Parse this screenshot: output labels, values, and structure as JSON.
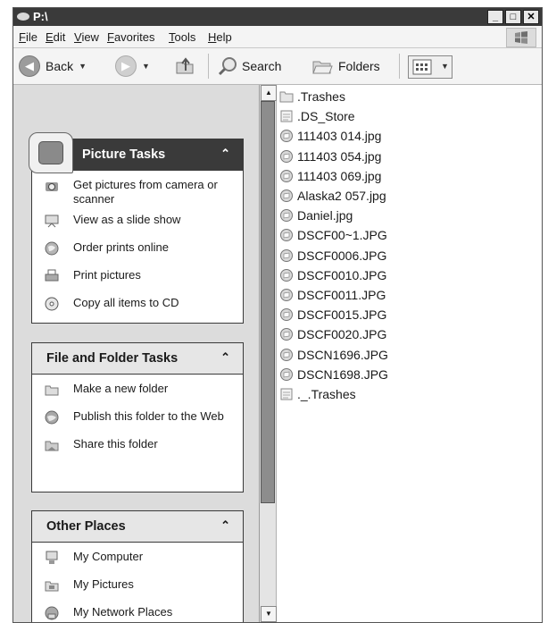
{
  "window": {
    "title": "P:\\"
  },
  "menu": [
    {
      "name": "file",
      "label": "File"
    },
    {
      "name": "edit",
      "label": "Edit"
    },
    {
      "name": "view",
      "label": "View"
    },
    {
      "name": "favorites",
      "label": "Favorites"
    },
    {
      "name": "tools",
      "label": "Tools"
    },
    {
      "name": "help",
      "label": "Help"
    }
  ],
  "toolbar": {
    "back_label": "Back",
    "search_label": "Search",
    "folders_label": "Folders"
  },
  "picture_tasks": {
    "title": "Picture Tasks",
    "items": [
      {
        "label": "Get pictures from camera or scanner",
        "icon": "camera-icon"
      },
      {
        "label": "View as a slide show",
        "icon": "slideshow-icon"
      },
      {
        "label": "Order prints online",
        "icon": "globe-icon"
      },
      {
        "label": "Print pictures",
        "icon": "printer-icon"
      },
      {
        "label": "Copy all items to CD",
        "icon": "cd-icon"
      }
    ]
  },
  "folder_tasks": {
    "title": "File and Folder Tasks",
    "items": [
      {
        "label": "Make a new folder",
        "icon": "new-folder-icon"
      },
      {
        "label": "Publish this folder to the Web",
        "icon": "globe-icon"
      },
      {
        "label": "Share this folder",
        "icon": "share-folder-icon"
      }
    ]
  },
  "other_places": {
    "title": "Other Places",
    "items": [
      {
        "label": "My Computer",
        "icon": "computer-icon"
      },
      {
        "label": "My Pictures",
        "icon": "pictures-folder-icon"
      },
      {
        "label": "My Network Places",
        "icon": "network-icon"
      }
    ]
  },
  "files": [
    {
      "name": ".Trashes",
      "type": "folder"
    },
    {
      "name": ".DS_Store",
      "type": "file"
    },
    {
      "name": "111403 014.jpg",
      "type": "image"
    },
    {
      "name": "111403 054.jpg",
      "type": "image"
    },
    {
      "name": "111403 069.jpg",
      "type": "image"
    },
    {
      "name": "Alaska2 057.jpg",
      "type": "image"
    },
    {
      "name": "Daniel.jpg",
      "type": "image"
    },
    {
      "name": "DSCF00~1.JPG",
      "type": "image"
    },
    {
      "name": "DSCF0006.JPG",
      "type": "image"
    },
    {
      "name": "DSCF0010.JPG",
      "type": "image"
    },
    {
      "name": "DSCF0011.JPG",
      "type": "image"
    },
    {
      "name": "DSCF0015.JPG",
      "type": "image"
    },
    {
      "name": "DSCF0020.JPG",
      "type": "image"
    },
    {
      "name": "DSCN1696.JPG",
      "type": "image"
    },
    {
      "name": "DSCN1698.JPG",
      "type": "image"
    },
    {
      "name": "._.Trashes",
      "type": "file"
    }
  ],
  "colors": {
    "titlebar": "#3a3a3a",
    "pane": "#dcdcdc",
    "panel_border": "#3a3a3a"
  }
}
